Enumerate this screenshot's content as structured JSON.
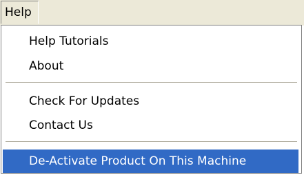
{
  "menubar": {
    "title": "Help"
  },
  "menu": {
    "items": [
      {
        "label": "Help  Tutorials",
        "highlighted": false
      },
      {
        "label": "About",
        "highlighted": false
      },
      {
        "label": "Check For Updates",
        "highlighted": false
      },
      {
        "label": "Contact Us",
        "highlighted": false
      },
      {
        "label": "De-Activate Product On This Machine",
        "highlighted": true
      }
    ]
  },
  "colors": {
    "menubar_bg": "#ece9d8",
    "highlight_bg": "#316ac5",
    "highlight_text": "#ffffff",
    "separator": "#aca899"
  }
}
